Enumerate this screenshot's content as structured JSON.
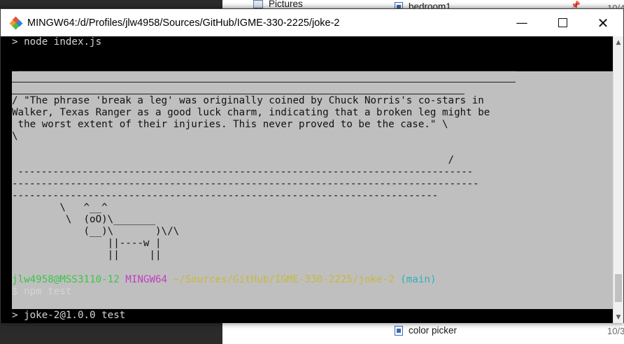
{
  "background": {
    "rows": [
      {
        "label": "Pictures",
        "type": "folder"
      },
      {
        "label": "bedroom1",
        "type": "doc"
      },
      {
        "label": "color picker",
        "type": "doc"
      }
    ],
    "dates": [
      "10/4",
      "10/3"
    ]
  },
  "window": {
    "title": "MINGW64:/d/Profiles/jlw4958/Sources/GitHub/IGME-330-2225/joke-2",
    "controls": {
      "minimize": "—",
      "maximize": "",
      "close": "✕"
    }
  },
  "terminal": {
    "cmd1": "> node index.js",
    "bubble_top": " ____________________________________________________________________________",
    "bubble_top2": "/ \"The phrase 'break a leg' was originally coined by Chuck Norris's co-stars in",
    "bubble_line1": "/ \"The phrase 'break a leg' was originally coined by Chuck Norris's co-stars in",
    "bubble_line2": "Walker, Texas Ranger as a good luck charm, indicating that a broken leg might be",
    "bubble_line3": " the worst extent of their injuries. This never proved to be the case.\" \\",
    "bubble_line4": "\\",
    "bubble_line5": "                                                                         /",
    "dashes1": " ------------------------------------------------------------------------------",
    "dashes2": "--------------------------------------------------------------------------------",
    "dashes3": "-------------------------------------------------------------------------",
    "cow1": "        \\   ^__^",
    "cow2": "         \\  (oO)\\_______",
    "cow3": "            (__)\\       )\\/\\",
    "cow4": "                ||----w |",
    "cow5": "                ||     ||",
    "prompt_user": "jlw4958@MSS3110-12",
    "prompt_env": "MINGW64",
    "prompt_path": "~/Sources/GitHub/IGME-330-2225/joke-2",
    "prompt_branch": "(main)",
    "cmd2": "$ npm test",
    "cmd3": "> joke-2@1.0.0 test"
  }
}
